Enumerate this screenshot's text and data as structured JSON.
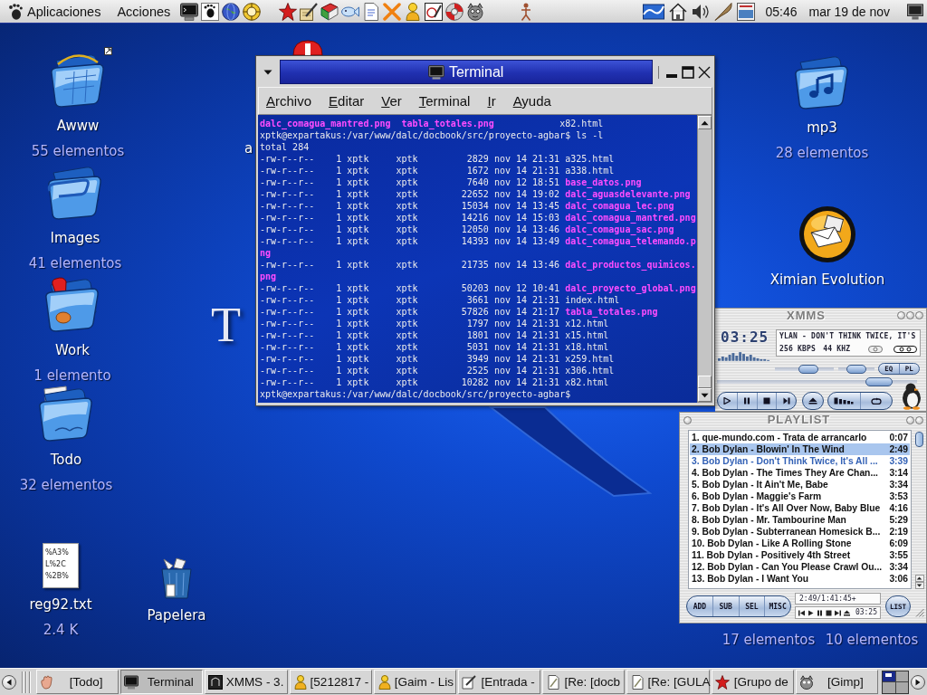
{
  "top_panel": {
    "menus": [
      "Aplicaciones",
      "Acciones"
    ],
    "clock": "05:46",
    "date": "mar 19 de nov"
  },
  "desktop": {
    "wallpaper_text": "T",
    "icons": [
      {
        "kind": "web",
        "label": "Awww",
        "sublabel": "55 elementos",
        "symlink": true
      },
      {
        "kind": "images",
        "label": "Images",
        "sublabel": "41 elementos",
        "symlink": false
      },
      {
        "kind": "work",
        "label": "Work",
        "sublabel": "1 elemento",
        "symlink": false
      },
      {
        "kind": "book",
        "label": "Todo",
        "sublabel": "32 elementos",
        "symlink": false
      },
      {
        "kind": "text",
        "label": "reg92.txt",
        "sublabel": "2.4 K",
        "preview": [
          "%A3%",
          "L%2C",
          "%2B%"
        ],
        "symlink": false
      },
      {
        "kind": "trash",
        "label": "Papelera",
        "symlink": false
      },
      {
        "kind": "covered",
        "label": "a",
        "symlink": false
      },
      {
        "kind": "music",
        "label": "mp3",
        "sublabel": "28 elementos",
        "symlink": false
      },
      {
        "kind": "mail",
        "label": "Ximian Evolution",
        "symlink": false
      },
      {
        "kind": "covered",
        "sublabel": "17 elementos",
        "symlink": false
      },
      {
        "kind": "covered",
        "sublabel": "10 elementos",
        "symlink": false
      }
    ]
  },
  "terminal": {
    "title": "Terminal",
    "menu": [
      "Archivo",
      "Editar",
      "Ver",
      "Terminal",
      "Ir",
      "Ayuda"
    ],
    "output": [
      {
        "kind": "columns",
        "items": [
          {
            "text": "dalc_comagua_mantred.png",
            "kind": "image"
          },
          {
            "text": "tabla_totales.png",
            "kind": "image"
          },
          {
            "text": "x82.html",
            "kind": "file"
          }
        ]
      },
      {
        "kind": "prompt",
        "text": "xptk@expartakus:/var/www/dalc/docbook/src/proyecto-agbar$ ls -l"
      },
      {
        "kind": "plain",
        "text": "total 284"
      },
      {
        "kind": "entry",
        "info": "-rw-r--r--    1 xptk     xptk         2829 nov 14 21:31",
        "file": {
          "name": "a325.html",
          "kind": "file"
        }
      },
      {
        "kind": "entry",
        "info": "-rw-r--r--    1 xptk     xptk         1672 nov 14 21:31",
        "file": {
          "name": "a338.html",
          "kind": "file"
        }
      },
      {
        "kind": "entry",
        "info": "-rw-r--r--    1 xptk     xptk         7640 nov 12 18:51",
        "file": {
          "name": "base_datos.png",
          "kind": "image"
        }
      },
      {
        "kind": "entry",
        "info": "-rw-r--r--    1 xptk     xptk        22652 nov 14 19:02",
        "file": {
          "name": "dalc_aguasdelevante.png",
          "kind": "image"
        }
      },
      {
        "kind": "entry",
        "info": "-rw-r--r--    1 xptk     xptk        15034 nov 14 13:45",
        "file": {
          "name": "dalc_comagua_lec.png",
          "kind": "image"
        }
      },
      {
        "kind": "entry",
        "info": "-rw-r--r--    1 xptk     xptk        14216 nov 14 15:03",
        "file": {
          "name": "dalc_comagua_mantred.png",
          "kind": "image"
        }
      },
      {
        "kind": "entry",
        "info": "-rw-r--r--    1 xptk     xptk        12050 nov 14 13:46",
        "file": {
          "name": "dalc_comagua_sac.png",
          "kind": "image"
        }
      },
      {
        "kind": "entry",
        "info": "-rw-r--r--    1 xptk     xptk        14393 nov 14 13:49",
        "file": {
          "name": "dalc_comagua_telemando.p",
          "wrap": "ng",
          "kind": "image"
        }
      },
      {
        "kind": "entry",
        "info": "-rw-r--r--    1 xptk     xptk        21735 nov 14 13:46",
        "file": {
          "name": "dalc_productos_quimicos.",
          "wrap": "png",
          "kind": "image"
        }
      },
      {
        "kind": "entry",
        "info": "-rw-r--r--    1 xptk     xptk        50203 nov 12 10:41",
        "file": {
          "name": "dalc_proyecto_global.png",
          "kind": "image"
        }
      },
      {
        "kind": "entry",
        "info": "-rw-r--r--    1 xptk     xptk         3661 nov 14 21:31",
        "file": {
          "name": "index.html",
          "kind": "file"
        }
      },
      {
        "kind": "entry",
        "info": "-rw-r--r--    1 xptk     xptk        57826 nov 14 21:17",
        "file": {
          "name": "tabla_totales.png",
          "kind": "image"
        }
      },
      {
        "kind": "entry",
        "info": "-rw-r--r--    1 xptk     xptk         1797 nov 14 21:31",
        "file": {
          "name": "x12.html",
          "kind": "file"
        }
      },
      {
        "kind": "entry",
        "info": "-rw-r--r--    1 xptk     xptk         1801 nov 14 21:31",
        "file": {
          "name": "x15.html",
          "kind": "file"
        }
      },
      {
        "kind": "entry",
        "info": "-rw-r--r--    1 xptk     xptk         5031 nov 14 21:31",
        "file": {
          "name": "x18.html",
          "kind": "file"
        }
      },
      {
        "kind": "entry",
        "info": "-rw-r--r--    1 xptk     xptk         3949 nov 14 21:31",
        "file": {
          "name": "x259.html",
          "kind": "file"
        }
      },
      {
        "kind": "entry",
        "info": "-rw-r--r--    1 xptk     xptk         2525 nov 14 21:31",
        "file": {
          "name": "x306.html",
          "kind": "file"
        }
      },
      {
        "kind": "entry",
        "info": "-rw-r--r--    1 xptk     xptk        10282 nov 14 21:31",
        "file": {
          "name": "x82.html",
          "kind": "file"
        }
      },
      {
        "kind": "prompt",
        "text": "xptk@expartakus:/var/www/dalc/docbook/src/proyecto-agbar$"
      }
    ]
  },
  "xmms": {
    "title": "XMMS",
    "time": "03:25",
    "song": "YLAN - DON'T THINK TWICE, IT'S",
    "bitrate": "256 KBPS",
    "samplerate": "44 KHZ",
    "volume": {
      "level": 0.6
    },
    "balance": {
      "level": 0.5
    },
    "seek": {
      "level": 0.86
    },
    "toggles": [
      "EQ",
      "PL"
    ]
  },
  "playlist": {
    "title": "PLAYLIST",
    "tracks": [
      {
        "title": "1. que-mundo.com - Trata de arrancarlo",
        "duration": "0:07",
        "selected": false,
        "playing": false
      },
      {
        "title": "2. Bob Dylan - Blowin' In The Wind",
        "duration": "2:49",
        "selected": true,
        "playing": false
      },
      {
        "title": "3. Bob Dylan - Don't Think Twice, It's All ...",
        "duration": "3:39",
        "selected": false,
        "playing": true
      },
      {
        "title": "4. Bob Dylan - The Times They Are Chan...",
        "duration": "3:14",
        "selected": false,
        "playing": false
      },
      {
        "title": "5. Bob Dylan - It Ain't Me, Babe",
        "duration": "3:34",
        "selected": false,
        "playing": false
      },
      {
        "title": "6. Bob Dylan - Maggie's Farm",
        "duration": "3:53",
        "selected": false,
        "playing": false
      },
      {
        "title": "7. Bob Dylan - It's All Over Now, Baby Blue",
        "duration": "4:16",
        "selected": false,
        "playing": false
      },
      {
        "title": "8. Bob Dylan - Mr. Tambourine Man",
        "duration": "5:29",
        "selected": false,
        "playing": false
      },
      {
        "title": "9. Bob Dylan - Subterranean Homesick B...",
        "duration": "2:19",
        "selected": false,
        "playing": false
      },
      {
        "title": "10. Bob Dylan - Like A Rolling Stone",
        "duration": "6:09",
        "selected": false,
        "playing": false
      },
      {
        "title": "11. Bob Dylan - Positively 4th Street",
        "duration": "3:55",
        "selected": false,
        "playing": false
      },
      {
        "title": "12. Bob Dylan - Can You Please Crawl Ou...",
        "duration": "3:34",
        "selected": false,
        "playing": false
      },
      {
        "title": "13. Bob Dylan - I Want You",
        "duration": "3:06",
        "selected": false,
        "playing": false
      }
    ],
    "buttons": [
      "ADD",
      "SUB",
      "SEL",
      "MISC"
    ],
    "info": "2:49/1:41:45+",
    "mini_time": "03:25",
    "list_button": "LIST"
  },
  "taskbar": {
    "tasks": [
      {
        "kind": "folder",
        "label": "[Todo]",
        "selected": false
      },
      {
        "kind": "terminal",
        "label": "Terminal",
        "selected": true
      },
      {
        "kind": "player",
        "label": "XMMS - 3.",
        "selected": false
      },
      {
        "kind": "chat",
        "label": "[5212817 -",
        "selected": false
      },
      {
        "kind": "chat",
        "label": "[Gaim - Lis",
        "selected": false
      },
      {
        "kind": "mail",
        "label": "[Entrada -",
        "selected": false
      },
      {
        "kind": "editor",
        "label": "[Re: [docb",
        "selected": false
      },
      {
        "kind": "editor",
        "label": "[Re: [GULA",
        "selected": false
      },
      {
        "kind": "star",
        "label": "[Grupo de",
        "selected": false
      },
      {
        "kind": "gimp",
        "label": "[Gimp]",
        "selected": false
      }
    ],
    "workspaces": [
      {
        "selected": true
      },
      {
        "selected": false
      },
      {
        "selected": false
      },
      {
        "selected": false
      }
    ]
  }
}
